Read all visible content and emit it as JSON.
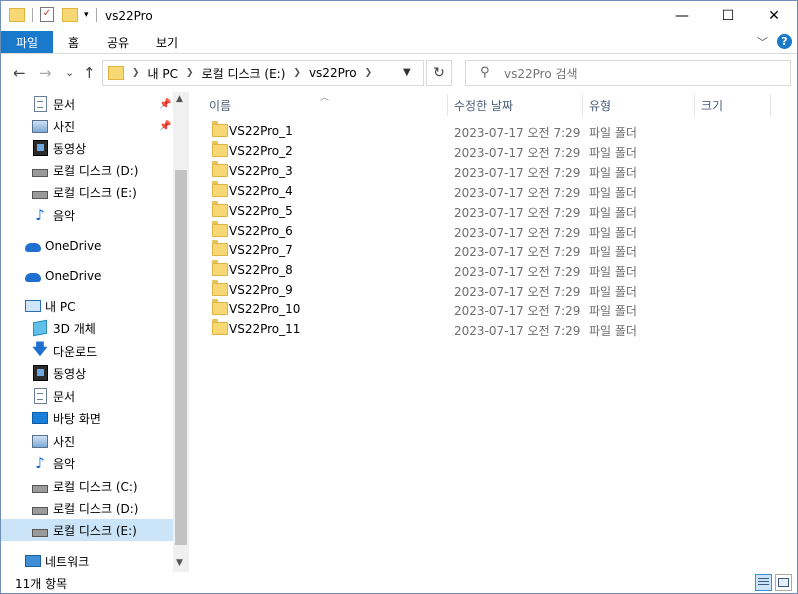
{
  "window": {
    "title": "vs22Pro",
    "buttons": {
      "minimize": "—",
      "maximize": "☐",
      "close": "✕"
    }
  },
  "ribbon": {
    "tabs": [
      {
        "label": "파일"
      },
      {
        "label": "홈"
      },
      {
        "label": "공유"
      },
      {
        "label": "보기"
      }
    ],
    "collapse_glyph": "﹀",
    "help": "?"
  },
  "nav": {
    "back": "←",
    "forward": "→",
    "recent": "⌄",
    "up": "↑",
    "breadcrumb": [
      "내 PC",
      "로컬 디스크 (E:)",
      "vs22Pro"
    ],
    "refresh": "↻",
    "search_placeholder": "vs22Pro 검색"
  },
  "sidebar": {
    "items": [
      {
        "label": "문서",
        "icon": "document-icon",
        "pinned": true
      },
      {
        "label": "사진",
        "icon": "picture-icon",
        "pinned": true
      },
      {
        "label": "동영상",
        "icon": "video-icon"
      },
      {
        "label": "로컬 디스크 (D:)",
        "icon": "drive-icon"
      },
      {
        "label": "로컬 디스크 (E:)",
        "icon": "drive-icon"
      },
      {
        "label": "음악",
        "icon": "music-icon"
      },
      {
        "label": "OneDrive",
        "icon": "onedrive-icon"
      },
      {
        "label": "OneDrive",
        "icon": "onedrive-icon"
      },
      {
        "label": "내 PC",
        "icon": "pc-icon"
      },
      {
        "label": "3D 개체",
        "icon": "3d-objects-icon"
      },
      {
        "label": "다운로드",
        "icon": "download-icon"
      },
      {
        "label": "동영상",
        "icon": "video-icon"
      },
      {
        "label": "문서",
        "icon": "document-icon"
      },
      {
        "label": "바탕 화면",
        "icon": "desktop-icon"
      },
      {
        "label": "사진",
        "icon": "picture-icon"
      },
      {
        "label": "음악",
        "icon": "music-icon"
      },
      {
        "label": "로컬 디스크 (C:)",
        "icon": "drive-icon"
      },
      {
        "label": "로컬 디스크 (D:)",
        "icon": "drive-icon"
      },
      {
        "label": "로컬 디스크 (E:)",
        "icon": "drive-icon",
        "selected": true
      },
      {
        "label": "네트워크",
        "icon": "network-icon"
      }
    ]
  },
  "columns": {
    "name": "이름",
    "modified": "수정한 날짜",
    "type": "유형",
    "size": "크기"
  },
  "files": [
    {
      "name": "VS22Pro_1",
      "modified": "2023-07-17 오전 7:29",
      "type": "파일 폴더"
    },
    {
      "name": "VS22Pro_2",
      "modified": "2023-07-17 오전 7:29",
      "type": "파일 폴더"
    },
    {
      "name": "VS22Pro_3",
      "modified": "2023-07-17 오전 7:29",
      "type": "파일 폴더"
    },
    {
      "name": "VS22Pro_4",
      "modified": "2023-07-17 오전 7:29",
      "type": "파일 폴더"
    },
    {
      "name": "VS22Pro_5",
      "modified": "2023-07-17 오전 7:29",
      "type": "파일 폴더"
    },
    {
      "name": "VS22Pro_6",
      "modified": "2023-07-17 오전 7:29",
      "type": "파일 폴더"
    },
    {
      "name": "VS22Pro_7",
      "modified": "2023-07-17 오전 7:29",
      "type": "파일 폴더"
    },
    {
      "name": "VS22Pro_8",
      "modified": "2023-07-17 오전 7:29",
      "type": "파일 폴더"
    },
    {
      "name": "VS22Pro_9",
      "modified": "2023-07-17 오전 7:29",
      "type": "파일 폴더"
    },
    {
      "name": "VS22Pro_10",
      "modified": "2023-07-17 오전 7:29",
      "type": "파일 폴더"
    },
    {
      "name": "VS22Pro_11",
      "modified": "2023-07-17 오전 7:29",
      "type": "파일 폴더"
    }
  ],
  "status": {
    "item_count": "11개 항목"
  },
  "colors": {
    "accent": "#1979ca",
    "selection": "#cce4f7",
    "folder": "#f8d775"
  }
}
